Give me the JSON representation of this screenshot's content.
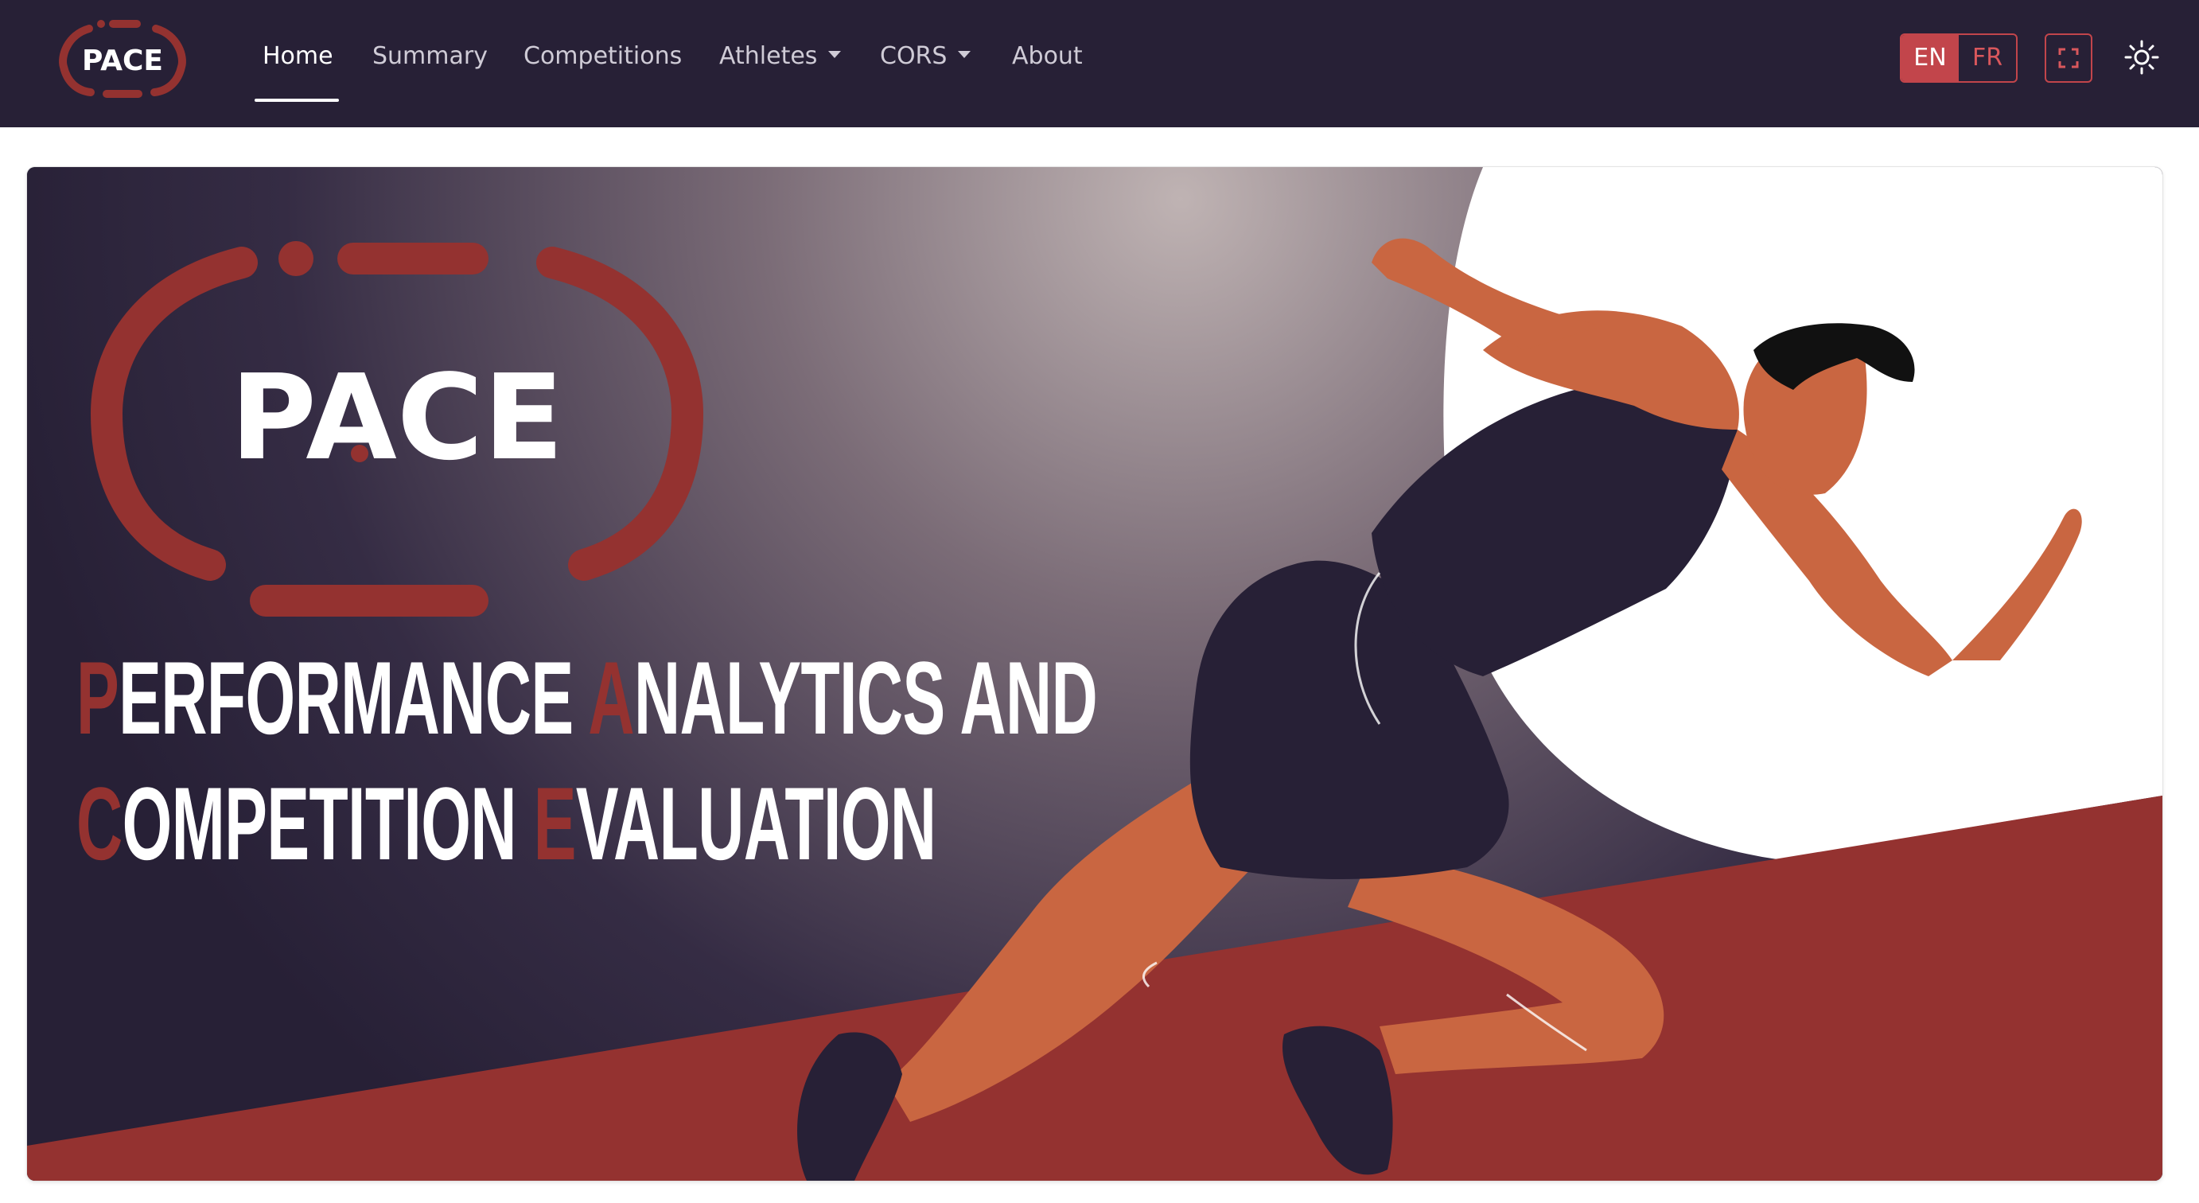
{
  "brand": {
    "logo_text": "PACE",
    "accent_color": "#943230",
    "nav_bg": "#272036"
  },
  "nav": {
    "items": [
      {
        "label": "Home",
        "active": true
      },
      {
        "label": "Summary"
      },
      {
        "label": "Competitions"
      },
      {
        "label": "Athletes",
        "dropdown": true
      },
      {
        "label": "CORS",
        "dropdown": true
      },
      {
        "label": "About"
      }
    ]
  },
  "lang": {
    "en": "EN",
    "fr": "FR",
    "selected": "EN"
  },
  "icons": {
    "fullscreen": "fullscreen-icon",
    "theme": "sun-icon"
  },
  "hero": {
    "logo_text": "PACE",
    "line1": [
      {
        "cap": "P",
        "rest": "ERFORMANCE "
      },
      {
        "cap": "A",
        "rest": "NALYTICS AND"
      }
    ],
    "line2": [
      {
        "cap": "C",
        "rest": "OMPETITION "
      },
      {
        "cap": "E",
        "rest": "VALUATION"
      }
    ]
  }
}
